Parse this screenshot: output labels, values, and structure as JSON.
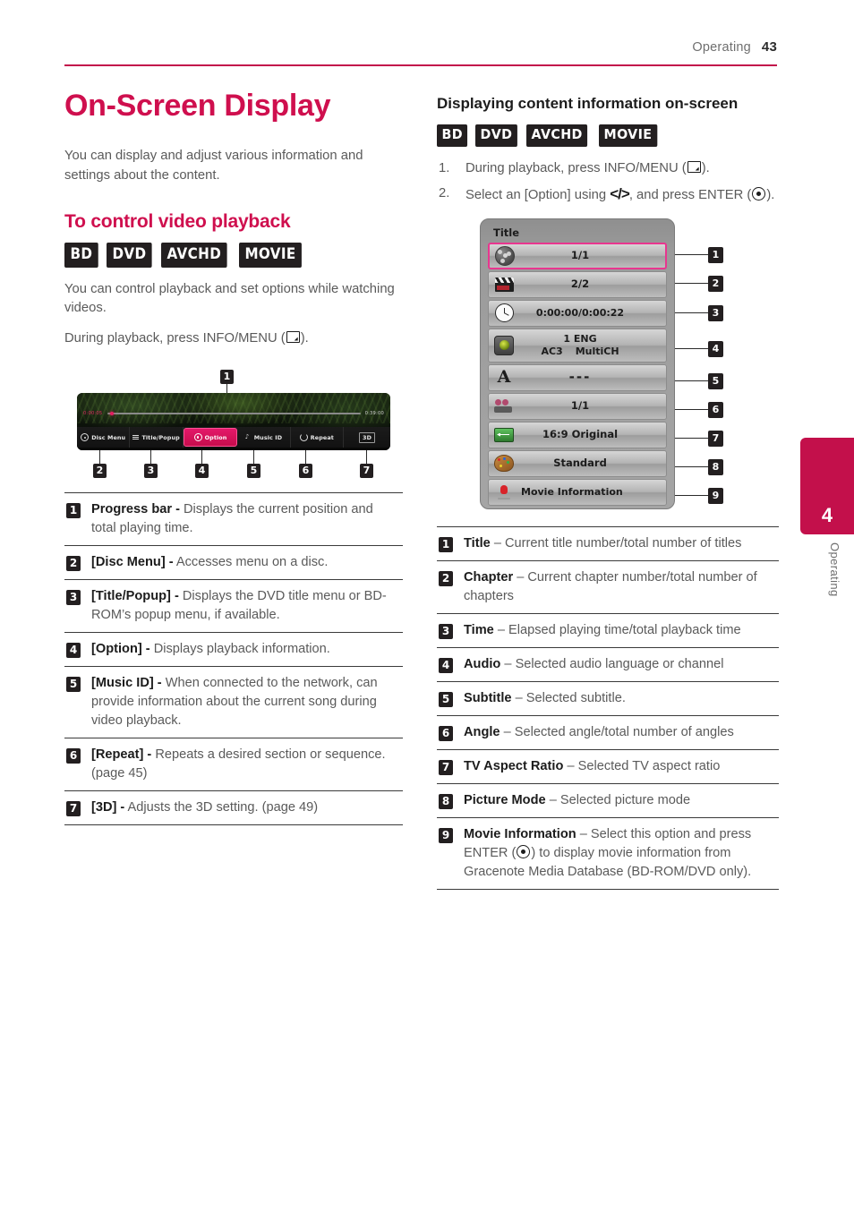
{
  "header": {
    "section": "Operating",
    "page_number": "43"
  },
  "side_tab": {
    "chapter_number": "4",
    "chapter_label": "Operating"
  },
  "left": {
    "title": "On-Screen Display",
    "intro": "You can display and adjust various information and settings about the content.",
    "section_heading": "To control video playback",
    "badges": [
      "BD",
      "DVD",
      "AVCHD",
      "MOVIE"
    ],
    "para1": "You can control playback and set options while watching videos.",
    "para2_before": "During playback, press INFO/MENU (",
    "para2_after": ").",
    "figure": {
      "callout_top": "1",
      "time_elapsed": "0:00:05",
      "time_total": "0:39:00",
      "buttons": [
        {
          "label": "Disc Menu",
          "icon": "disc-icon",
          "selected": false
        },
        {
          "label": "Title/Popup",
          "icon": "lines-icon",
          "selected": false
        },
        {
          "label": "Option",
          "icon": "gear-icon",
          "selected": true
        },
        {
          "label": "Music ID",
          "icon": "note-icon",
          "selected": false
        },
        {
          "label": "Repeat",
          "icon": "repeat-icon",
          "selected": false
        },
        {
          "label": "3D",
          "icon": "three-d-icon",
          "selected": false
        }
      ],
      "callouts_bottom": [
        "2",
        "3",
        "4",
        "5",
        "6",
        "7"
      ]
    },
    "definitions": [
      {
        "num": "1",
        "term": "Progress bar -",
        "desc": "Displays the current position and total playing time."
      },
      {
        "num": "2",
        "term": "[Disc Menu] -",
        "desc": "Accesses menu on a disc."
      },
      {
        "num": "3",
        "term": "[Title/Popup] -",
        "desc": "Displays the DVD title menu or BD-ROM’s popup menu, if available."
      },
      {
        "num": "4",
        "term": "[Option] -",
        "desc": "Displays playback information."
      },
      {
        "num": "5",
        "term": "[Music ID] -",
        "desc": "When connected to the network, can provide information about the current song during video playback."
      },
      {
        "num": "6",
        "term": "[Repeat] -",
        "desc": "Repeats a desired section or sequence. (page 45)"
      },
      {
        "num": "7",
        "term": "[3D] -",
        "desc": "Adjusts the 3D setting. (page 49)"
      }
    ]
  },
  "right": {
    "heading": "Displaying content information on-screen",
    "badges": [
      "BD",
      "DVD",
      "AVCHD",
      "MOVIE"
    ],
    "steps": [
      {
        "num": "1.",
        "before": "During playback, press INFO/MENU (",
        "after": ")."
      },
      {
        "num": "2.",
        "before": "Select an [Option] using ",
        "arrows": "</>",
        "mid": ", and press ENTER (",
        "after": ")."
      }
    ],
    "osd": {
      "title": "Title",
      "rows": [
        {
          "callout": "1",
          "icon": "film-reel-icon",
          "value": "1/1",
          "selected": true
        },
        {
          "callout": "2",
          "icon": "clapperboard-icon",
          "value": "2/2",
          "selected": false
        },
        {
          "callout": "3",
          "icon": "clock-icon",
          "value": "0:00:00/0:00:22",
          "selected": false
        },
        {
          "callout": "4",
          "icon": "audio-disc-icon",
          "value": "1 ENG",
          "value_line2_a": "AC3",
          "value_line2_b": "MultiCH",
          "selected": false
        },
        {
          "callout": "5",
          "icon": "subtitle-a-icon",
          "value": "---",
          "selected": false
        },
        {
          "callout": "6",
          "icon": "movie-camera-icon",
          "value": "1/1",
          "selected": false
        },
        {
          "callout": "7",
          "icon": "aspect-ratio-icon",
          "value": "16:9 Original",
          "selected": false
        },
        {
          "callout": "8",
          "icon": "palette-icon",
          "value": "Standard",
          "selected": false
        },
        {
          "callout": "9",
          "icon": "gracenote-icon",
          "value": "Movie Information",
          "selected": false
        }
      ]
    },
    "definitions": [
      {
        "num": "1",
        "term": "Title",
        "desc": "– Current title number/total number of titles"
      },
      {
        "num": "2",
        "term": "Chapter",
        "desc": "– Current chapter number/total number of chapters"
      },
      {
        "num": "3",
        "term": "Time",
        "desc": "– Elapsed playing time/total playback time"
      },
      {
        "num": "4",
        "term": "Audio",
        "desc": "– Selected audio language or channel"
      },
      {
        "num": "5",
        "term": "Subtitle",
        "desc": "– Selected subtitle."
      },
      {
        "num": "6",
        "term": "Angle",
        "desc": "– Selected angle/total number of angles"
      },
      {
        "num": "7",
        "term": "TV Aspect Ratio",
        "desc": "– Selected TV aspect ratio"
      },
      {
        "num": "8",
        "term": "Picture Mode",
        "desc": "– Selected picture mode"
      },
      {
        "num": "9",
        "term": "Movie Information",
        "desc_pre": "– Select this option and press ENTER (",
        "desc_post": ") to display movie information from Gracenote Media Database (BD-ROM/DVD only)."
      }
    ]
  },
  "colors": {
    "accent": "#c3104b",
    "heading": "#cf0f4e",
    "badge_bg": "#231f20",
    "osd_select": "#e8368f"
  }
}
